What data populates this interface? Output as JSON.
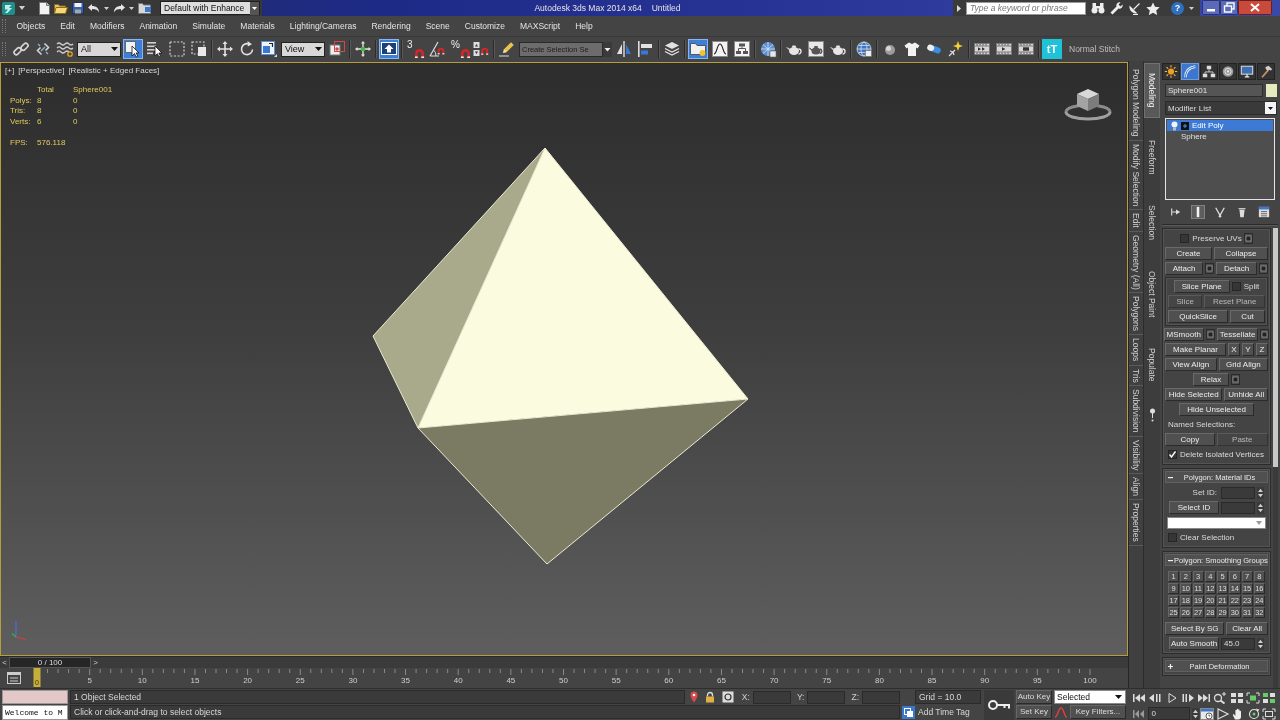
{
  "title_bar": {
    "workspace": "Default with Enhance",
    "app_title": "Autodesk 3ds Max 2014 x64",
    "document": "Untitled",
    "search": {
      "placeholder": "Type a keyword or phrase"
    },
    "help": "?"
  },
  "menu_bar": [
    "Objects",
    "Edit",
    "Modifiers",
    "Animation",
    "Simulate",
    "Materials",
    "Lighting/Cameras",
    "Rendering",
    "Scene",
    "Customize",
    "MAXScript",
    "Help"
  ],
  "main_toolbar": [
    {
      "kind": "tool",
      "on": false
    },
    {
      "kind": "tool",
      "on": false
    },
    {
      "kind": "tool",
      "on": false
    },
    {
      "kind": "dropdown",
      "value": "All"
    },
    {
      "kind": "tool",
      "on": true
    },
    {
      "kind": "tool",
      "on": false
    },
    {
      "kind": "tool",
      "on": false
    },
    {
      "kind": "tool",
      "on": false
    },
    {
      "kind": "separator"
    },
    {
      "kind": "tool",
      "on": false
    },
    {
      "kind": "tool",
      "on": false
    },
    {
      "kind": "tool",
      "on": false
    },
    {
      "kind": "dropdown",
      "value": "View"
    },
    {
      "kind": "tool",
      "on": false
    },
    {
      "kind": "separator"
    },
    {
      "kind": "tool",
      "on": false
    },
    {
      "kind": "separator"
    },
    {
      "kind": "tool",
      "on": true
    },
    {
      "kind": "separator"
    },
    {
      "kind": "tool",
      "on": false,
      "glyph": "3"
    },
    {
      "kind": "tool",
      "on": false
    },
    {
      "kind": "tool",
      "on": false,
      "glyph": "%"
    },
    {
      "kind": "tool",
      "on": false
    },
    {
      "kind": "separator"
    },
    {
      "kind": "tool",
      "on": false
    },
    {
      "kind": "dropdown",
      "placeholder": "Create Selection Se"
    },
    {
      "kind": "tool",
      "on": false
    },
    {
      "kind": "tool",
      "on": false
    },
    {
      "kind": "separator"
    },
    {
      "kind": "tool",
      "on": false
    },
    {
      "kind": "separator"
    },
    {
      "kind": "tool",
      "on": true
    },
    {
      "kind": "tool",
      "on": false
    },
    {
      "kind": "tool",
      "on": false
    },
    {
      "kind": "separator"
    },
    {
      "kind": "tool",
      "on": false
    },
    {
      "kind": "separator"
    },
    {
      "kind": "tool",
      "on": false
    },
    {
      "kind": "tool",
      "on": false
    },
    {
      "kind": "tool",
      "on": false
    },
    {
      "kind": "separator"
    },
    {
      "kind": "tool",
      "on": false
    },
    {
      "kind": "separator"
    },
    {
      "kind": "tool",
      "on": false
    },
    {
      "kind": "tool",
      "on": false
    },
    {
      "kind": "tool",
      "on": false
    },
    {
      "kind": "tool",
      "on": false
    },
    {
      "kind": "separator"
    },
    {
      "kind": "tool",
      "on": false
    },
    {
      "kind": "tool",
      "on": false
    },
    {
      "kind": "tool",
      "on": false
    },
    {
      "kind": "separator"
    },
    {
      "kind": "tool",
      "on": false,
      "glyph": "tT"
    },
    {
      "kind": "label",
      "text": "Normal Stitch"
    }
  ],
  "viewport": {
    "active": true,
    "labels": [
      "[+]",
      "[Perspective]",
      "[Realistic + Edged Faces]"
    ],
    "stats": {
      "columns": [
        "Total",
        "Sphere001"
      ],
      "rows": [
        {
          "label": "Polys:",
          "values": [
            "8",
            "0"
          ]
        },
        {
          "label": "Tris:",
          "values": [
            "8",
            "0"
          ]
        },
        {
          "label": "Verts:",
          "values": [
            "6",
            "0"
          ]
        }
      ],
      "fps": {
        "label": "FPS:",
        "value": "576.118"
      }
    }
  },
  "ribbon": {
    "panels": [
      "Polygon Modeling",
      "Modify Selection",
      "Edit",
      "Geometry (All)",
      "Polygons",
      "Loops",
      "Tris",
      "Subdivision",
      "Visibility",
      "Align",
      "Properties"
    ],
    "tabs": [
      {
        "label": "Modeling",
        "selected": true
      },
      {
        "label": "Freeform",
        "selected": false
      },
      {
        "label": "Selection",
        "selected": false
      },
      {
        "label": "Object Paint",
        "selected": false
      },
      {
        "label": "Populate",
        "selected": false
      }
    ]
  },
  "command_panel": {
    "tabs": [
      {
        "selected": false
      },
      {
        "selected": true
      },
      {
        "selected": false
      },
      {
        "selected": false
      },
      {
        "selected": false
      },
      {
        "selected": false
      }
    ],
    "object_name": "Sphere001",
    "modifier_list": "Modifier List",
    "stack": [
      {
        "label": "Edit Poly",
        "kind": "modifier",
        "selected": true
      },
      {
        "label": "Sphere",
        "kind": "object",
        "selected": false
      }
    ],
    "stack_tools": [
      {
        "on": false
      },
      {
        "on": true
      },
      {
        "on": false
      },
      {
        "on": false
      },
      {
        "on": false
      }
    ],
    "rollouts": [
      {
        "expanded": true,
        "items": [
          {
            "kind": "row",
            "controls": [
              {
                "kind": "checkbox",
                "label": "Preserve UVs",
                "checked": false
              },
              {
                "kind": "settings"
              }
            ]
          },
          {
            "kind": "row",
            "controls": [
              {
                "kind": "button",
                "label": "Create",
                "disabled": false
              },
              {
                "kind": "button",
                "label": "Collapse",
                "disabled": false
              }
            ]
          },
          {
            "kind": "row",
            "controls": [
              {
                "kind": "button",
                "label": "Attach",
                "disabled": false
              },
              {
                "kind": "settings"
              },
              {
                "kind": "button",
                "label": "Detach",
                "disabled": false
              },
              {
                "kind": "settings"
              }
            ]
          },
          {
            "kind": "group",
            "rows": [
              [
                {
                  "kind": "button",
                  "label": "Slice Plane",
                  "disabled": false
                },
                {
                  "kind": "checkbox",
                  "label": "Split",
                  "checked": false
                }
              ],
              [
                {
                  "kind": "button",
                  "label": "Slice",
                  "disabled": true
                },
                {
                  "kind": "button",
                  "label": "Reset Plane",
                  "disabled": true
                }
              ],
              [
                {
                  "kind": "button",
                  "label": "QuickSlice",
                  "disabled": false
                },
                {
                  "kind": "button",
                  "label": "Cut",
                  "disabled": false
                }
              ]
            ]
          },
          {
            "kind": "row",
            "controls": [
              {
                "kind": "button",
                "label": "MSmooth",
                "disabled": false
              },
              {
                "kind": "settings"
              },
              {
                "kind": "button",
                "label": "Tessellate",
                "disabled": false
              },
              {
                "kind": "settings"
              }
            ]
          },
          {
            "kind": "row",
            "controls": [
              {
                "kind": "button",
                "label": "Make Planar",
                "disabled": false
              },
              {
                "kind": "axis",
                "label": "X",
                "disabled": false
              },
              {
                "kind": "axis",
                "label": "Y",
                "disabled": false
              },
              {
                "kind": "axis",
                "label": "Z",
                "disabled": false
              }
            ]
          },
          {
            "kind": "row",
            "controls": [
              {
                "kind": "button",
                "label": "View Align",
                "disabled": false
              },
              {
                "kind": "button",
                "label": "Grid Align",
                "disabled": false
              }
            ]
          },
          {
            "kind": "row",
            "controls": [
              {
                "kind": "button",
                "label": "Relax",
                "disabled": false
              },
              {
                "kind": "settings"
              }
            ]
          },
          {
            "kind": "row",
            "controls": [
              {
                "kind": "button",
                "label": "Hide Selected",
                "disabled": false
              },
              {
                "kind": "button",
                "label": "Unhide All",
                "disabled": false
              }
            ]
          },
          {
            "kind": "row",
            "controls": [
              {
                "kind": "button",
                "label": "Hide Unselected",
                "disabled": false
              }
            ]
          },
          {
            "kind": "row",
            "controls": [
              {
                "kind": "label",
                "text": "Named Selections:"
              }
            ]
          },
          {
            "kind": "row",
            "controls": [
              {
                "kind": "button",
                "label": "Copy",
                "disabled": false
              },
              {
                "kind": "button",
                "label": "Paste",
                "disabled": true
              }
            ]
          },
          {
            "kind": "row",
            "controls": [
              {
                "kind": "checkbox",
                "label": "Delete Isolated Vertices",
                "checked": true
              }
            ]
          }
        ]
      },
      {
        "title": "Polygon: Material IDs",
        "expanded": true,
        "items": [
          {
            "kind": "row",
            "controls": [
              {
                "kind": "label",
                "text": "Set ID:"
              },
              {
                "kind": "spinner"
              }
            ]
          },
          {
            "kind": "row",
            "controls": [
              {
                "kind": "button",
                "label": "Select ID",
                "disabled": false
              },
              {
                "kind": "spinner"
              }
            ]
          },
          {
            "kind": "row",
            "controls": [
              {
                "kind": "dropdown"
              }
            ]
          },
          {
            "kind": "row",
            "controls": [
              {
                "kind": "checkbox",
                "label": "Clear Selection",
                "checked": false
              }
            ]
          }
        ]
      },
      {
        "title": "Polygon: Smoothing Groups",
        "expanded": true,
        "items": [
          {
            "kind": "grid",
            "labels": [
              "1",
              "2",
              "3",
              "4",
              "5",
              "6",
              "7",
              "8",
              "9",
              "10",
              "11",
              "12",
              "13",
              "14",
              "15",
              "16",
              "17",
              "18",
              "19",
              "20",
              "21",
              "22",
              "23",
              "24",
              "25",
              "26",
              "27",
              "28",
              "29",
              "30",
              "31",
              "32"
            ]
          },
          {
            "kind": "row",
            "controls": [
              {
                "kind": "button",
                "label": "Select By SG",
                "disabled": false
              },
              {
                "kind": "button",
                "label": "Clear All",
                "disabled": false
              }
            ]
          },
          {
            "kind": "row",
            "controls": [
              {
                "kind": "button",
                "label": "Auto Smooth",
                "disabled": false
              },
              {
                "kind": "spinner",
                "value": "45.0"
              }
            ]
          }
        ]
      },
      {
        "title": "Paint Deformation",
        "expanded": false
      }
    ]
  },
  "time_slider": {
    "prev": "<",
    "label": "0 / 100",
    "next": ">",
    "level": 0
  },
  "track_bar": {
    "current": "0",
    "ticks": [
      "5",
      "10",
      "15",
      "20",
      "25",
      "30",
      "35",
      "40",
      "45",
      "50",
      "55",
      "60",
      "65",
      "70",
      "75",
      "80",
      "85",
      "90",
      "95",
      "100"
    ]
  },
  "status_bar": {
    "listener_output": "Welcome to M",
    "selection": "1 Object Selected",
    "prompt": "Click or click-and-drag to select objects",
    "coordinates": [
      "X:",
      "Y:",
      "Z:"
    ],
    "grid": "Grid = 10.0",
    "time_tag": "Add Time Tag",
    "auto_key": {
      "label": "Auto Key",
      "on": false
    },
    "key_mode": "Selected",
    "set_key": "Set Key",
    "key_filters": "Key Filters...",
    "frame": "0"
  }
}
